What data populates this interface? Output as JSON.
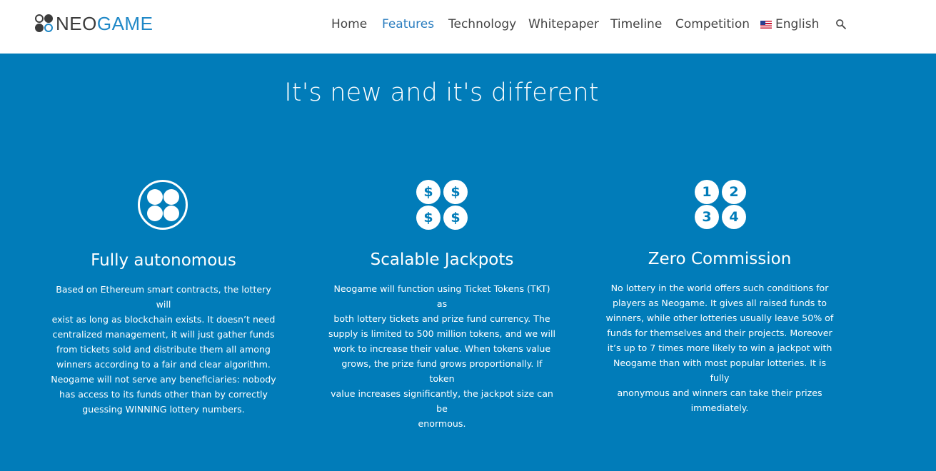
{
  "logo": {
    "neo": "NEO",
    "game": "GAME"
  },
  "nav": {
    "items": [
      {
        "label": "Home"
      },
      {
        "label": "Features"
      },
      {
        "label": "Technology"
      },
      {
        "label": "Whitepaper"
      },
      {
        "label": "Timeline"
      },
      {
        "label": "Competition"
      }
    ],
    "language": "English",
    "search_icon": "search-icon",
    "colors": {
      "active": "#2a7dbf",
      "text": "#444444"
    }
  },
  "colors": {
    "background": "#017cb9"
  },
  "hero": {
    "title": "It's new and it's different"
  },
  "features": [
    {
      "icon": "four-circles-icon",
      "title": "Fully autonomous",
      "lines": [
        "Based on Ethereum smart contracts, the lottery will",
        "exist as long as blockchain exists. It doesn’t need",
        "centralized management, it will just gather funds",
        "from tickets sold and distribute them all among",
        "winners according to a fair and clear algorithm.",
        "Neogame will not serve any beneficiaries: nobody",
        "has access to its funds other than by correctly",
        "guessing WINNING lottery numbers."
      ]
    },
    {
      "icon": "dollar-coins-icon",
      "coin_symbols": [
        "$",
        "$",
        "$",
        "$"
      ],
      "title": "Scalable Jackpots",
      "lines": [
        "Neogame will function using Ticket Tokens (TKT) as",
        "both lottery tickets and prize fund currency. The",
        "supply is limited to 500 million tokens, and we will",
        "work to increase their value. When tokens value",
        "grows, the prize fund grows proportionally. If token",
        "value increases significantly, the jackpot size can be",
        "enormous."
      ]
    },
    {
      "icon": "numbered-balls-icon",
      "ball_numbers": [
        "1",
        "2",
        "3",
        "4"
      ],
      "title": "Zero Commission",
      "lines": [
        "No lottery in the world offers such conditions for",
        "players as Neogame. It gives all raised funds to",
        "winners, while other lotteries usually leave 50% of",
        "funds for themselves and their projects. Moreover",
        "it’s up to 7 times more likely to win a jackpot with",
        "Neogame than with most popular lotteries. It is fully",
        "anonymous and winners can take their prizes",
        "immediately."
      ]
    }
  ]
}
